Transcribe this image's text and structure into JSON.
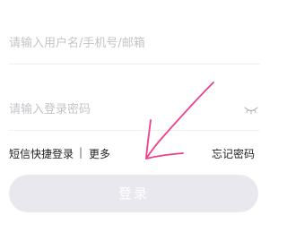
{
  "login_form": {
    "username": {
      "value": "",
      "placeholder": "请输入用户名/手机号/邮箱"
    },
    "password": {
      "value": "",
      "placeholder": "请输入登录密码",
      "visibility_icon": "eye-closed-icon"
    },
    "links": {
      "sms_login": "短信快捷登录",
      "divider": "|",
      "more": "更多",
      "forgot_password": "忘记密码"
    },
    "login_button": "登录"
  },
  "colors": {
    "annotation_arrow": "#ee3f8e",
    "button_disabled_bg": "#e8e8ee",
    "placeholder_text": "#c4c4c8"
  }
}
